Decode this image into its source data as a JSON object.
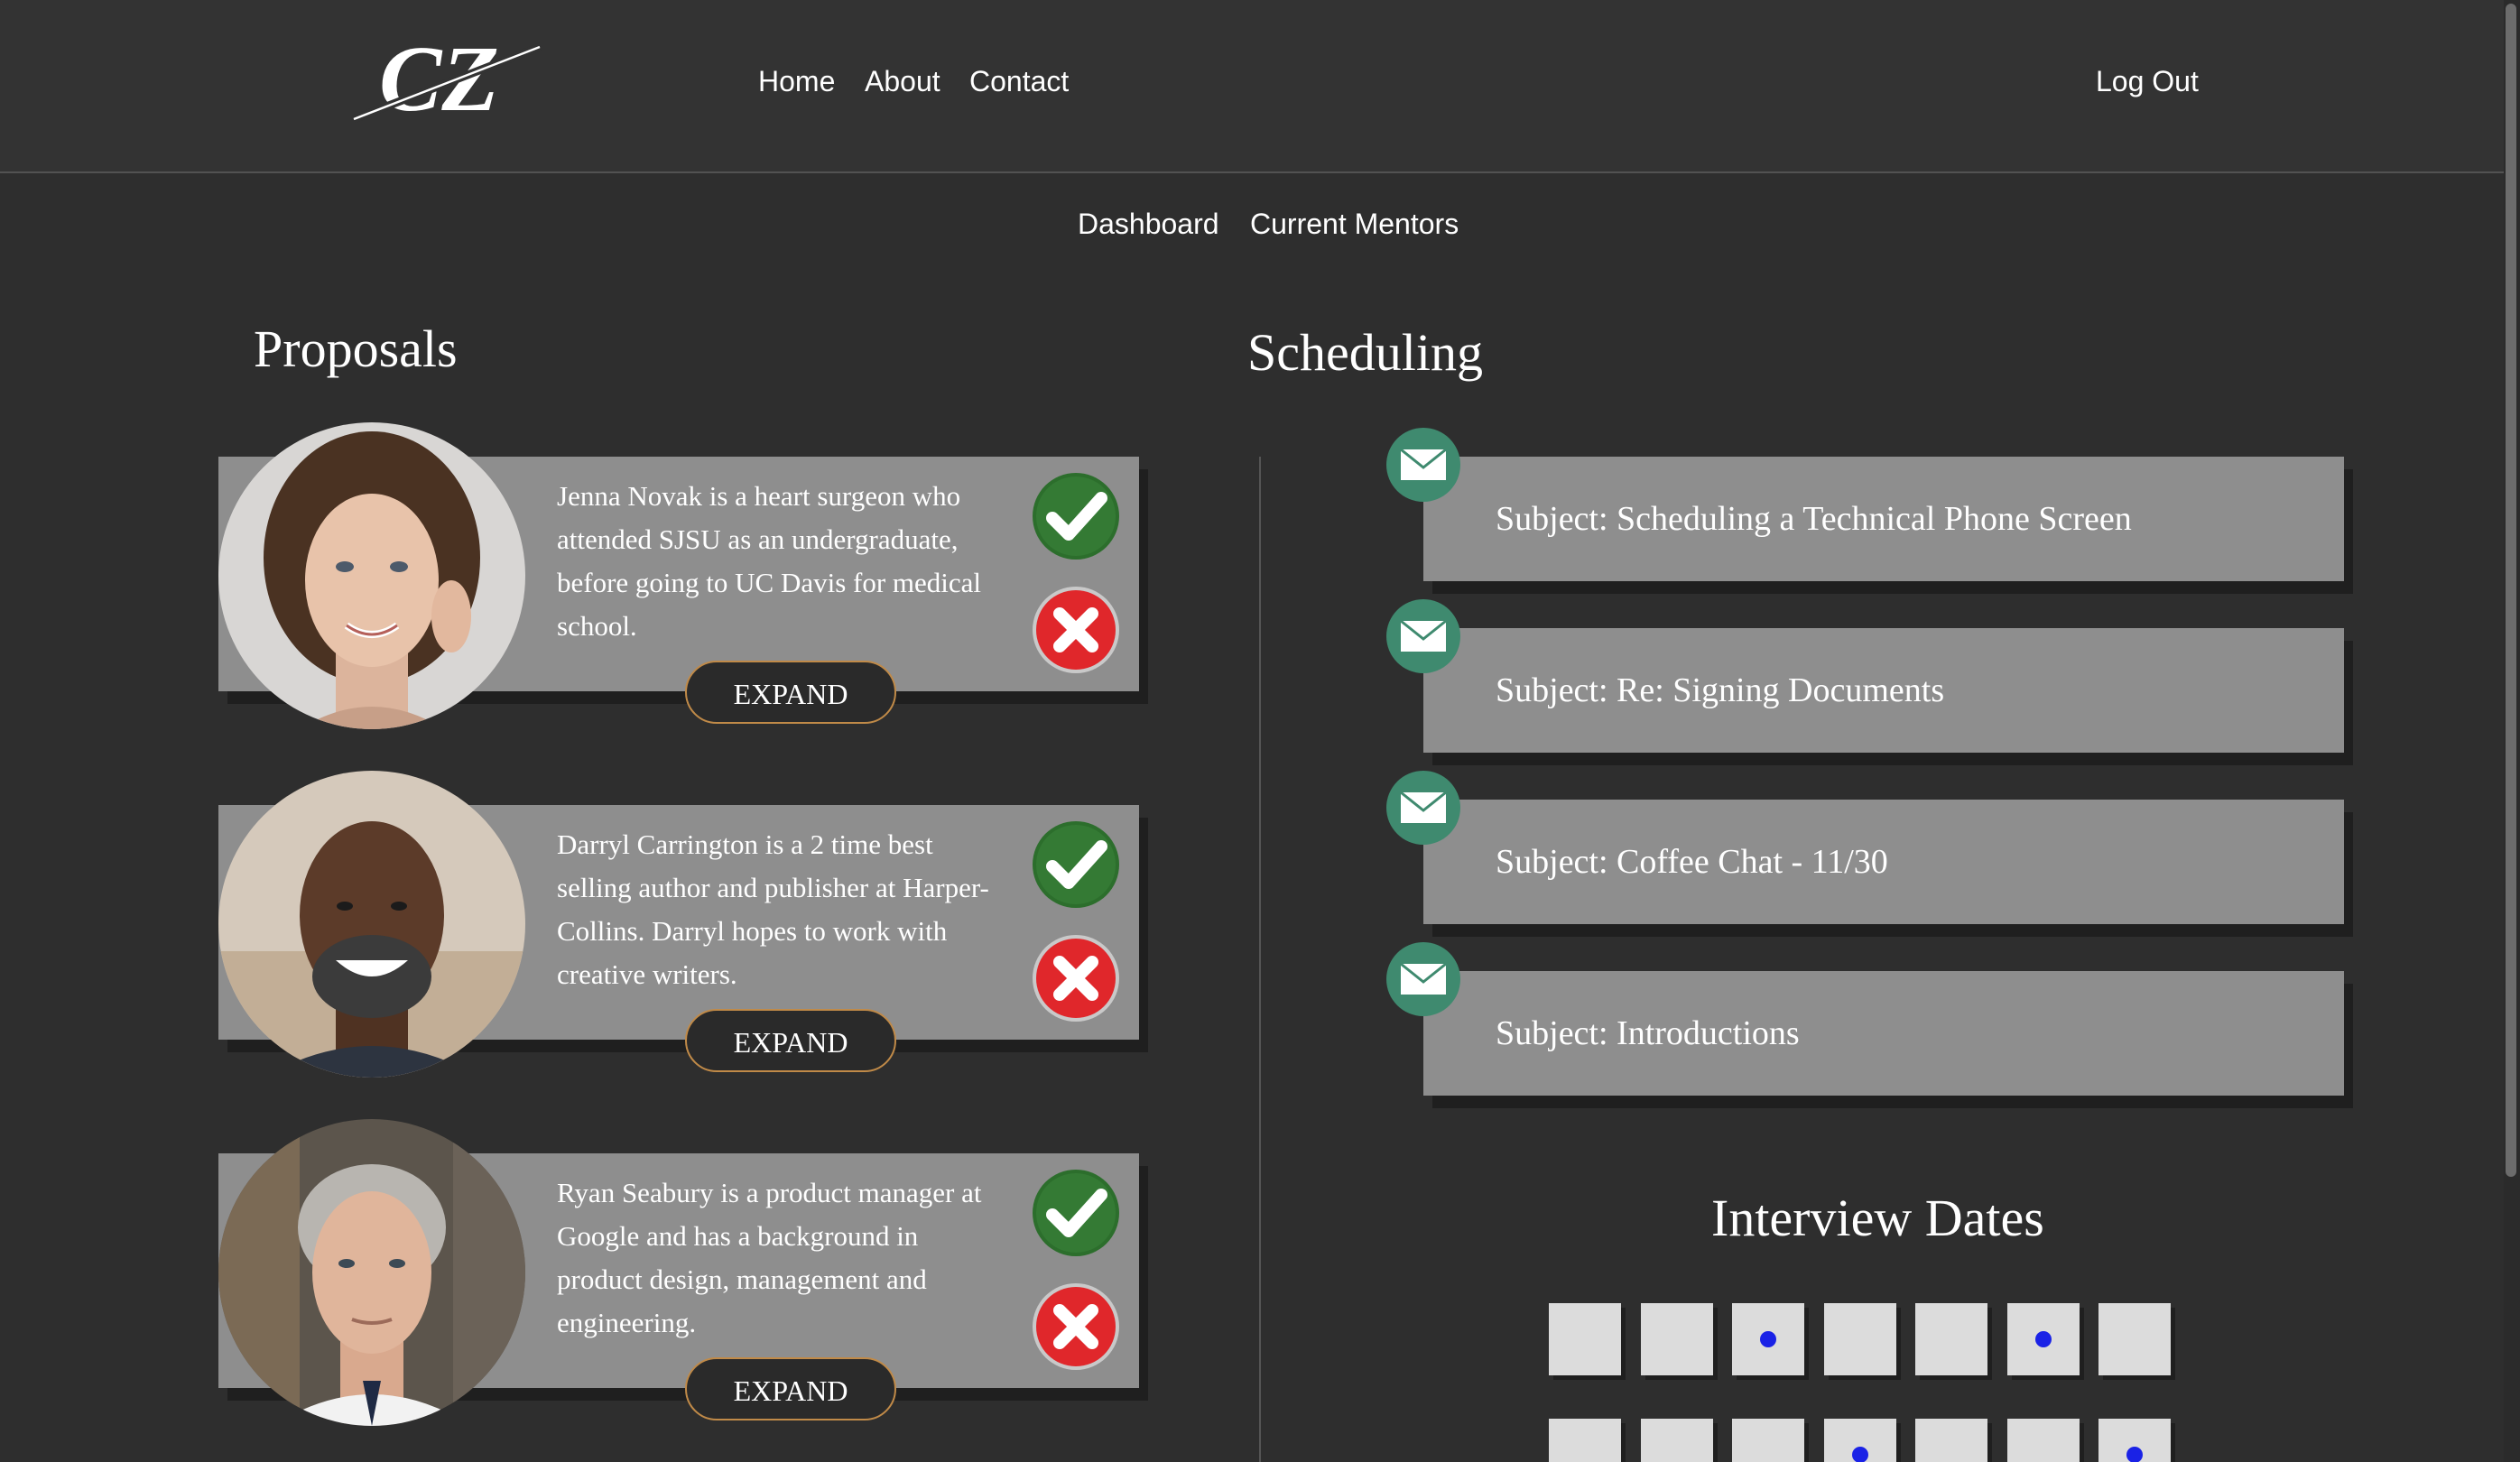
{
  "header": {
    "logo_text": "CZ",
    "nav": {
      "home": "Home",
      "about": "About",
      "contact": "Contact"
    },
    "logout": "Log Out"
  },
  "subnav": {
    "dashboard": "Dashboard",
    "mentors": "Current Mentors"
  },
  "proposals": {
    "title": "Proposals",
    "expand_label": "EXPAND",
    "items": [
      {
        "bio": "Jenna Novak is a heart surgeon who attended SJSU as an undergraduate, before going to UC Davis for medical school."
      },
      {
        "bio": "Darryl Carrington is a 2 time best selling author and publisher at Harper-Collins. Darryl hopes to work with creative writers."
      },
      {
        "bio": "Ryan Seabury is a product manager at Google and has a background in product design, management and engineering."
      }
    ]
  },
  "scheduling": {
    "title": "Scheduling",
    "messages": [
      {
        "subject": "Subject: Scheduling a Technical Phone Screen"
      },
      {
        "subject": "Subject: Re: Signing Documents"
      },
      {
        "subject": "Subject: Coffee Chat - 11/30"
      },
      {
        "subject": "Subject: Introductions"
      }
    ]
  },
  "interview_dates": {
    "title": "Interview Dates",
    "rows": [
      [
        false,
        false,
        true,
        false,
        false,
        true,
        false
      ],
      [
        false,
        false,
        false,
        true,
        false,
        false,
        true
      ]
    ]
  },
  "colors": {
    "background": "#2e2e2e",
    "card": "#8e8e8e",
    "mail_icon": "#3f8a6f",
    "accept": "#2c6e2c",
    "reject": "#e0272b",
    "expand_border": "#c08a48",
    "date_dot": "#1a22e6"
  }
}
